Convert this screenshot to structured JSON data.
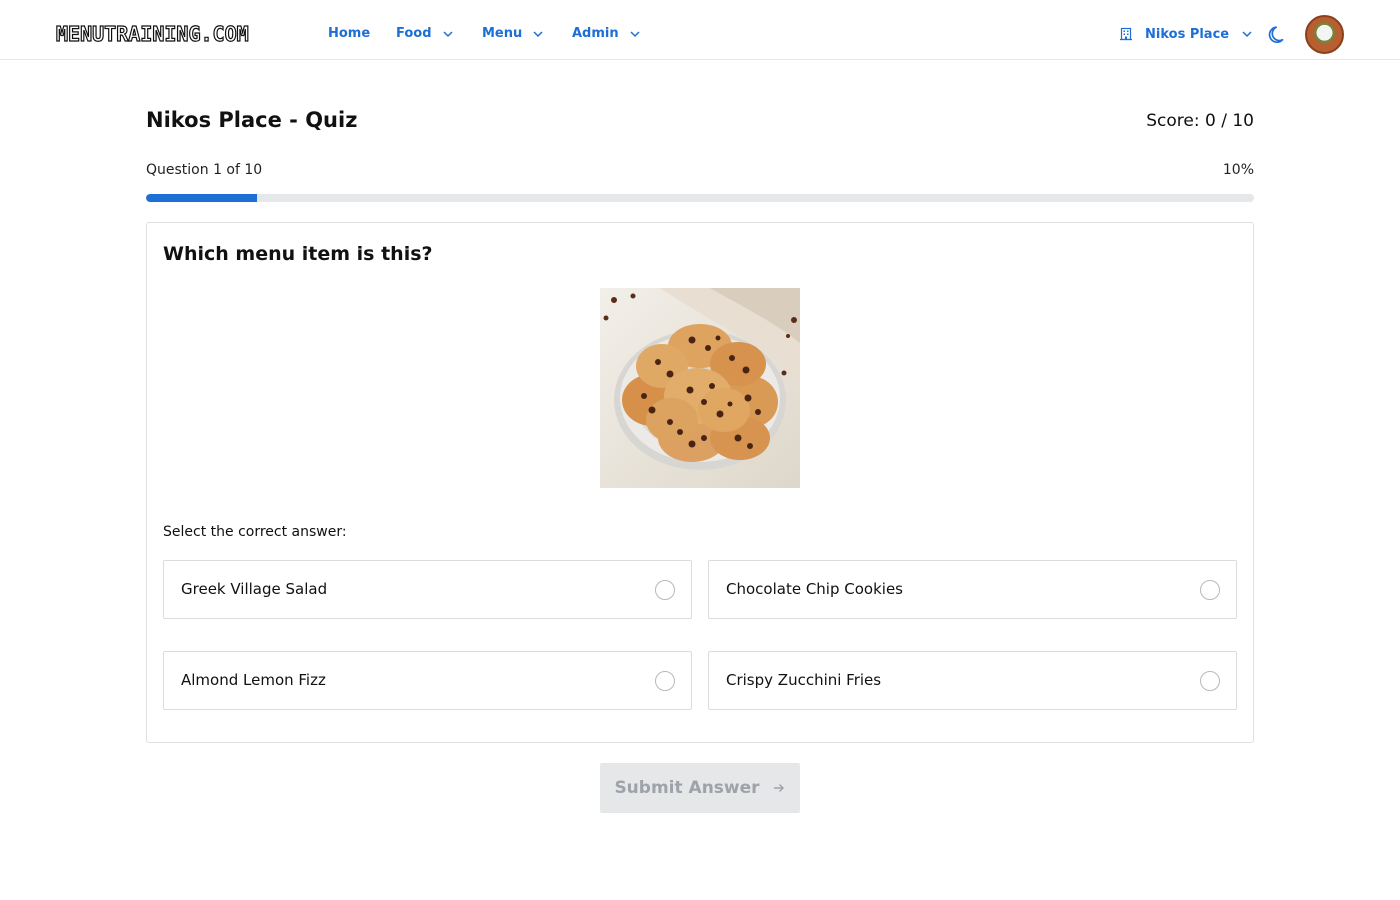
{
  "brand": {
    "logo_text": "MENUTRAINING.COM"
  },
  "nav": {
    "home": "Home",
    "food": "Food",
    "menu": "Menu",
    "admin": "Admin",
    "venue": "Nikos Place"
  },
  "icons": {
    "dropdown": "chevron-down-icon",
    "venue": "building-icon",
    "theme": "moon-icon",
    "submit": "arrow-right-icon"
  },
  "quiz": {
    "title": "Nikos Place - Quiz",
    "score": "Score: 0 / 10",
    "question_counter": "Question 1 of 10",
    "progress_percent": "10%",
    "progress_value": 0.1,
    "question": "Which menu item is this?",
    "image_alt": "Chocolate chip cookies on a plate",
    "prompt": "Select the correct answer:",
    "options": [
      {
        "label": "Greek Village Salad",
        "selected": false
      },
      {
        "label": "Chocolate Chip Cookies",
        "selected": false
      },
      {
        "label": "Almond Lemon Fizz",
        "selected": false
      },
      {
        "label": "Crispy Zucchini Fries",
        "selected": false
      }
    ],
    "submit_label": "Submit Answer",
    "submit_enabled": false
  },
  "colors": {
    "accent": "#1d6fd6",
    "progress_track": "#e5e7eb",
    "border": "#dcdcdc",
    "submit_disabled_bg": "#e6e7e9",
    "submit_disabled_text": "#9ea3aa"
  }
}
